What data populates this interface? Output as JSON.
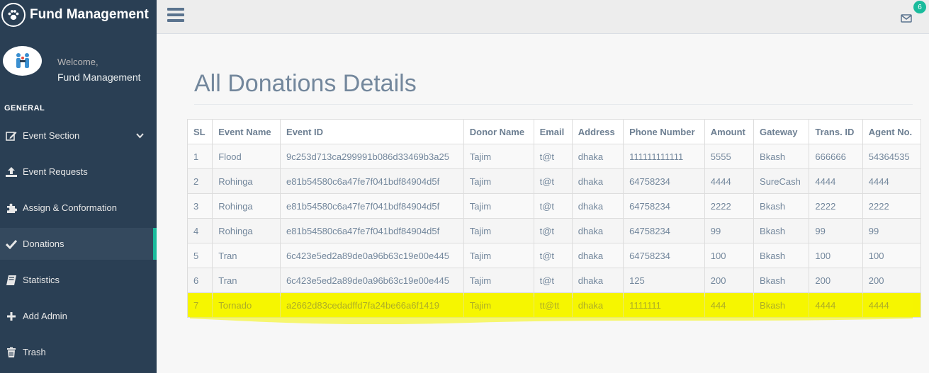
{
  "brand": {
    "title": "Fund Management"
  },
  "profile": {
    "welcome": "Welcome,",
    "name": "Fund Management"
  },
  "sidebar": {
    "section": "GENERAL",
    "items": [
      {
        "label": "Event Section",
        "icon": "edit-icon"
      },
      {
        "label": "Event Requests",
        "icon": "upload-icon"
      },
      {
        "label": "Assign & Conformation",
        "icon": "puzzle-icon"
      },
      {
        "label": "Donations",
        "icon": "check-icon"
      },
      {
        "label": "Statistics",
        "icon": "book-icon"
      },
      {
        "label": "Add Admin",
        "icon": "plus-icon"
      },
      {
        "label": "Trash",
        "icon": "trash-icon"
      }
    ]
  },
  "topbar": {
    "mail_badge": "6"
  },
  "page": {
    "title": "All Donations Details"
  },
  "table": {
    "headers": [
      "SL",
      "Event Name",
      "Event ID",
      "Donor Name",
      "Email",
      "Address",
      "Phone Number",
      "Amount",
      "Gateway",
      "Trans. ID",
      "Agent No."
    ],
    "rows": [
      [
        "1",
        "Flood",
        "9c253d713ca299991b086d33469b3a25",
        "Tajim",
        "t@t",
        "dhaka",
        "111111111111",
        "5555",
        "Bkash",
        "666666",
        "54364535"
      ],
      [
        "2",
        "Rohinga",
        "e81b54580c6a47fe7f041bdf84904d5f",
        "Tajim",
        "t@t",
        "dhaka",
        "64758234",
        "4444",
        "SureCash",
        "4444",
        "4444"
      ],
      [
        "3",
        "Rohinga",
        "e81b54580c6a47fe7f041bdf84904d5f",
        "Tajim",
        "t@t",
        "dhaka",
        "64758234",
        "2222",
        "Bkash",
        "2222",
        "2222"
      ],
      [
        "4",
        "Rohinga",
        "e81b54580c6a47fe7f041bdf84904d5f",
        "Tajim",
        "t@t",
        "dhaka",
        "64758234",
        "99",
        "Bkash",
        "99",
        "99"
      ],
      [
        "5",
        "Tran",
        "6c423e5ed2a89de0a96b63c19e00e445",
        "Tajim",
        "t@t",
        "dhaka",
        "64758234",
        "100",
        "Bkash",
        "100",
        "100"
      ],
      [
        "6",
        "Tran",
        "6c423e5ed2a89de0a96b63c19e00e445",
        "Tajim",
        "t@t",
        "dhaka",
        "125",
        "200",
        "Bkash",
        "200",
        "200"
      ],
      [
        "7",
        "Tornado",
        "a2662d83cedadffd7fa24be66a6f1419",
        "Tajim",
        "tt@tt",
        "dhaka",
        "1111111",
        "444",
        "Bkash",
        "4444",
        "4444"
      ]
    ]
  },
  "colors": {
    "sidebar": "#2a3f54",
    "accent": "#1abb9c",
    "highlight": "#f6f500"
  }
}
